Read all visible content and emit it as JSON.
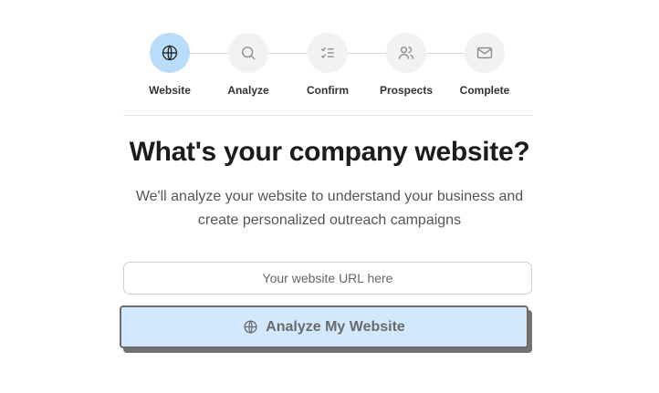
{
  "stepper": {
    "steps": [
      {
        "label": "Website",
        "icon": "globe-icon",
        "active": true
      },
      {
        "label": "Analyze",
        "icon": "search-icon",
        "active": false
      },
      {
        "label": "Confirm",
        "icon": "checklist-icon",
        "active": false
      },
      {
        "label": "Prospects",
        "icon": "users-icon",
        "active": false
      },
      {
        "label": "Complete",
        "icon": "mail-icon",
        "active": false
      }
    ]
  },
  "main": {
    "title": "What's your company website?",
    "subtitle": "We'll analyze your website to understand your business and create personalized outreach campaigns",
    "url_input": {
      "value": "",
      "placeholder": "Your website URL here"
    },
    "analyze_button": {
      "label": "Analyze My Website",
      "icon": "globe-icon"
    }
  },
  "colors": {
    "active_step_bg": "#b9dcfb",
    "inactive_step_bg": "#f2f2f2",
    "button_bg": "#d2e8fd",
    "button_border": "#6b6b6b"
  }
}
